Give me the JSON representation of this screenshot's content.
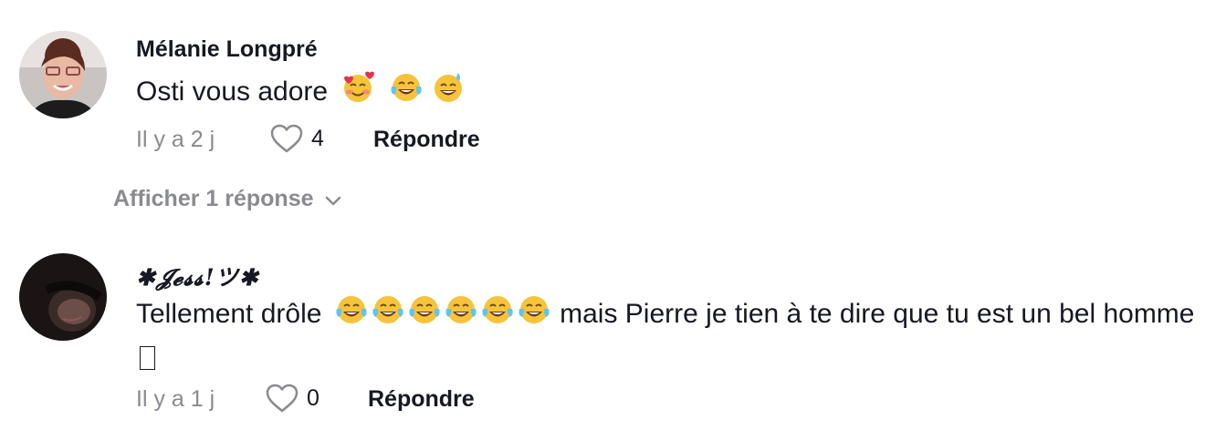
{
  "comments": [
    {
      "username": "Mélanie Longpré",
      "text": "Osti vous adore",
      "emojis": [
        "smiling-face-with-hearts",
        "face-with-tears-of-joy",
        "grinning-face-with-sweat"
      ],
      "time": "Il y a 2 j",
      "likes": "4",
      "reply_label": "Répondre"
    },
    {
      "username": "✱𝓙𝓮𝓼𝓼!ツ✱",
      "text_before": "Tellement drôle",
      "emojis": [
        "face-with-tears-of-joy",
        "face-with-tears-of-joy",
        "face-with-tears-of-joy",
        "face-with-tears-of-joy",
        "face-with-tears-of-joy",
        "face-with-tears-of-joy"
      ],
      "text_after": "mais Pierre je tien à te dire que tu est un bel homme",
      "time": "Il y a 1 j",
      "likes": "0",
      "reply_label": "Répondre"
    }
  ],
  "replies_toggle": {
    "label": "Afficher 1 réponse",
    "icon": "chevron-down-icon"
  },
  "colors": {
    "text": "#161823",
    "muted": "#8a8b91"
  }
}
